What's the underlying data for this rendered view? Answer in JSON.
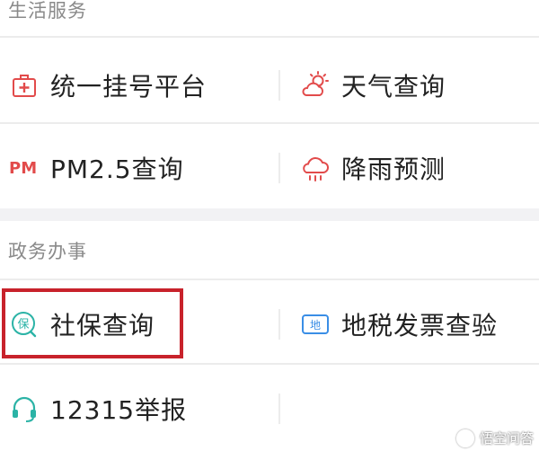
{
  "life_services": {
    "title": "生活服务",
    "items": [
      {
        "label": "统一挂号平台",
        "icon": "hospital-registration-icon"
      },
      {
        "label": "天气查询",
        "icon": "weather-sun-cloud-icon"
      },
      {
        "label": "PM2.5查询",
        "icon_text": "PM"
      },
      {
        "label": "降雨预测",
        "icon": "rain-cloud-icon"
      }
    ]
  },
  "gov_services": {
    "title": "政务办事",
    "items": [
      {
        "label": "社保查询",
        "icon_text": "保"
      },
      {
        "label": "地税发票查验",
        "icon_text": "地"
      },
      {
        "label": "12315举报",
        "icon": "headset-icon"
      }
    ]
  },
  "watermark": "悟空问答",
  "colors": {
    "accent_red": "#e24b4b",
    "accent_teal": "#2bb3a6",
    "accent_blue": "#3a8ee6",
    "highlight_border": "#c8222b"
  }
}
